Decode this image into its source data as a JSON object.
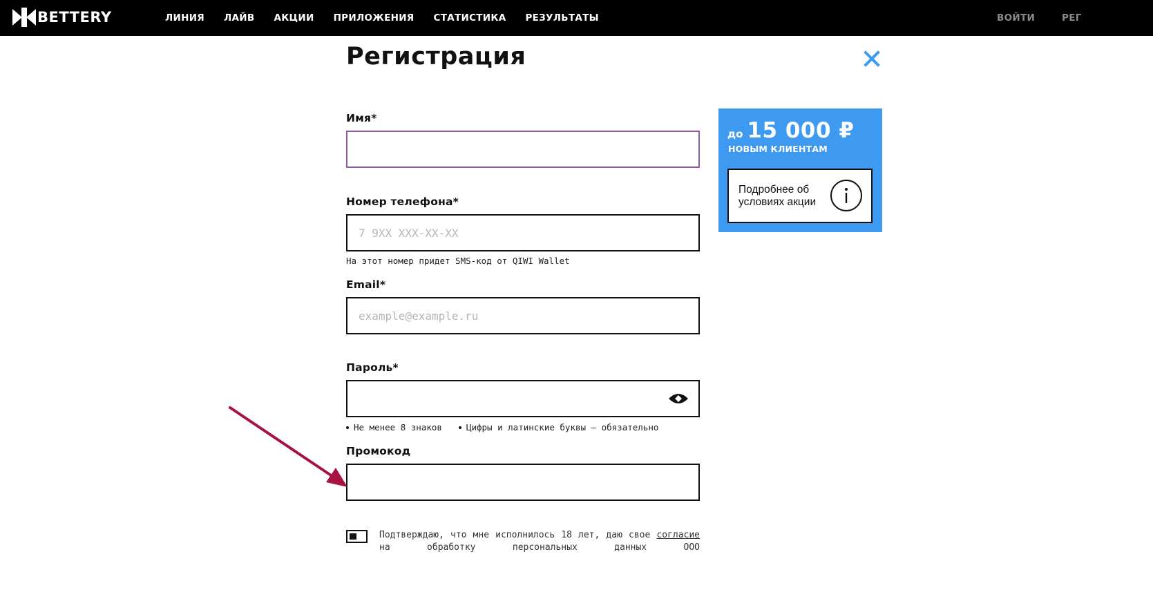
{
  "header": {
    "logo_text": "BETTERY",
    "nav": [
      "ЛИНИЯ",
      "ЛАЙВ",
      "АКЦИИ",
      "ПРИЛОЖЕНИЯ",
      "СТАТИСТИКА",
      "РЕЗУЛЬТАТЫ"
    ],
    "login_label": "ВОЙТИ",
    "register_label": "РЕГ"
  },
  "form": {
    "title": "Регистрация",
    "name": {
      "label": "Имя*",
      "value": "",
      "placeholder": ""
    },
    "phone": {
      "label": "Номер телефона*",
      "value": "",
      "placeholder": "7 9XX XXX-XX-XX",
      "hint": "На этот номер придет SMS-код от QIWI Wallet"
    },
    "email": {
      "label": "Email*",
      "value": "",
      "placeholder": "example@example.ru"
    },
    "password": {
      "label": "Пароль*",
      "value": "",
      "placeholder": "",
      "rules": [
        "Не менее 8 знаков",
        "Цифры и латинские буквы – обязательно"
      ]
    },
    "promo": {
      "label": "Промокод",
      "value": "",
      "placeholder": ""
    },
    "consent": {
      "text_before": "Подтверждаю, что мне исполнилось 18 лет, даю свое",
      "link": "согласие",
      "text_after": "на обработку персональных данных ООО"
    }
  },
  "promo_banner": {
    "prefix": "до",
    "amount": "15 000 ₽",
    "subtitle": "НОВЫМ КЛИЕНТАМ",
    "details_label": "Подробнее об условиях акции"
  },
  "colors": {
    "accent_blue": "#3d9af0",
    "focus_border": "#8e5aa0",
    "arrow": "#a8123e"
  },
  "icons": [
    "logo-icon",
    "close-icon",
    "eye-icon",
    "info-icon",
    "arrow-annotation"
  ]
}
